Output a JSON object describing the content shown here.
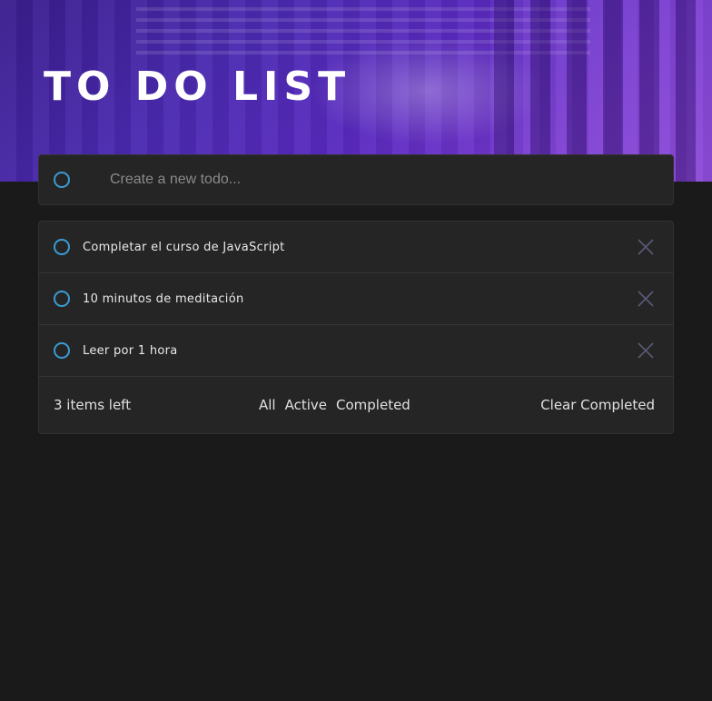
{
  "header": {
    "title": "TO DO LIST"
  },
  "new_todo": {
    "placeholder": "Create a new todo..."
  },
  "todos": [
    {
      "text": "Completar el curso de JavaScript"
    },
    {
      "text": "10 minutos de meditación"
    },
    {
      "text": "Leer por 1 hora"
    }
  ],
  "footer": {
    "items_left": "3 items left",
    "filters": [
      "All",
      "Active",
      "Completed"
    ],
    "clear_label": "Clear Completed"
  },
  "colors": {
    "accent": "#3a9bd5",
    "background": "#1a1a1a",
    "card": "#252525"
  },
  "icons": {
    "checkbox": "circle-icon",
    "delete": "close-icon"
  }
}
